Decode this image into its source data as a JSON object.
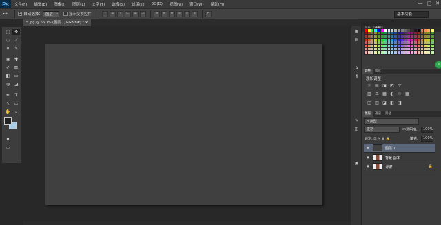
{
  "menubar": {
    "logo": "Ps",
    "items": [
      "文件(F)",
      "编辑(E)",
      "图像(I)",
      "图层(L)",
      "文字(Y)",
      "选择(S)",
      "滤镜(T)",
      "3D(D)",
      "视图(V)",
      "窗口(W)",
      "帮助(H)"
    ],
    "minimize": "—",
    "maximize": "▢",
    "close": "✕"
  },
  "options": {
    "tool_icon": "▸+",
    "auto_select_label": "自动选择：",
    "auto_select_value": "图层",
    "show_transform_label": "显示变换控件",
    "workspace": "基本功能"
  },
  "document": {
    "tab_title": "5.jpg @ 66.7% (图层 1, RGB/8#) *",
    "tab_close": "×"
  },
  "toolbox": {
    "tools": [
      "⬚",
      "✥",
      "◌",
      "⟋",
      "⌗",
      "✎",
      "◉",
      "✚",
      "✐",
      "⛾",
      "◧",
      "▭",
      "◍",
      "◢",
      "✒",
      "T",
      "↖",
      "▭",
      "✋",
      "⌕"
    ]
  },
  "panels": {
    "swatches_tabs": [
      "颜色",
      "色板"
    ],
    "adjust_tabs": [
      "调整",
      "样式"
    ],
    "adjust_title": "添加调整",
    "adjust_row1": [
      "☼",
      "▤",
      "◪",
      "◩",
      "▽"
    ],
    "adjust_row2": [
      "▥",
      "⚖",
      "▦",
      "◐",
      "♲",
      "▦"
    ],
    "adjust_row3": [
      "◫",
      "◫",
      "◪",
      "◧",
      "◨"
    ],
    "layers_tabs": [
      "图层",
      "通道",
      "路径"
    ],
    "kind": "ρ 类型",
    "blend": "正常",
    "opacity_label": "不透明度:",
    "opacity": "100%",
    "lock_label": "锁定: ⊡ ✎ ✥ 🔒",
    "fill_label": "填充:",
    "fill": "100%",
    "layers": [
      {
        "name": "图层 1",
        "selected": true
      },
      {
        "name": "背景 副本",
        "selected": false
      },
      {
        "name": "背景",
        "selected": false
      }
    ]
  },
  "swatch_colors": [
    "#ff0000",
    "#ffff00",
    "#00ff00",
    "#00ffff",
    "#0000ff",
    "#ff00ff",
    "#ffffff",
    "#e6e6e6",
    "#cccccc",
    "#b3b3b3",
    "#999999",
    "#808080",
    "#666666",
    "#4d4d4d",
    "#333333",
    "#1a1a1a",
    "#000000",
    "#f26c4f",
    "#f68e56",
    "#fbaf5d",
    "#fff568"
  ]
}
